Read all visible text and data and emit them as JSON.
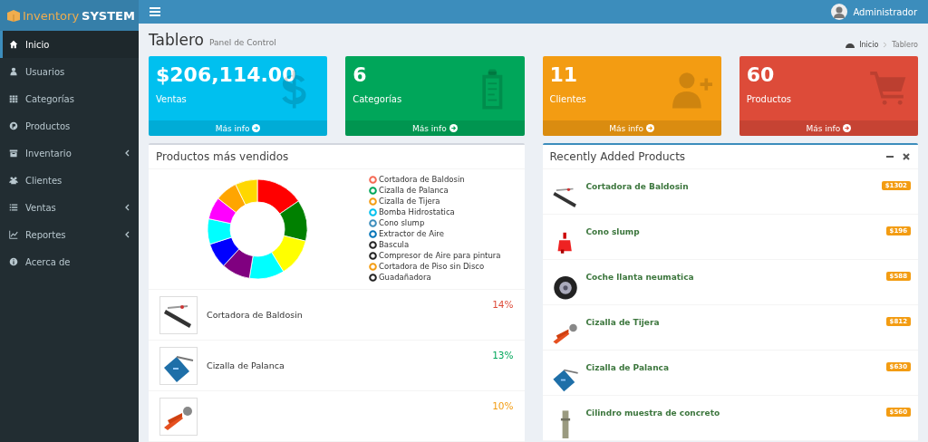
{
  "logo": {
    "part_1": "Inventory",
    "part_2": "SYSTEM"
  },
  "user": {
    "name": "Administrador"
  },
  "sidebar": {
    "items": [
      {
        "label": "Inicio",
        "selected": true,
        "has_submenu": false
      },
      {
        "label": "Usuarios",
        "selected": false,
        "has_submenu": false
      },
      {
        "label": "Categorías",
        "selected": false,
        "has_submenu": false
      },
      {
        "label": "Productos",
        "selected": false,
        "has_submenu": false
      },
      {
        "label": "Inventario",
        "selected": false,
        "has_submenu": true
      },
      {
        "label": "Clientes",
        "selected": false,
        "has_submenu": false
      },
      {
        "label": "Ventas",
        "selected": false,
        "has_submenu": true
      },
      {
        "label": "Reportes",
        "selected": false,
        "has_submenu": true
      },
      {
        "label": "Acerca de",
        "selected": false,
        "has_submenu": false
      }
    ]
  },
  "header": {
    "title": "Tablero",
    "subtitle": "Panel de Control",
    "breadcrumb": [
      "Inicio",
      "Tablero"
    ]
  },
  "stat_boxes": [
    {
      "value": "$206,114.00",
      "label": "Ventas",
      "link": "Más info",
      "color": "#00c0ef"
    },
    {
      "value": "6",
      "label": "Categorías",
      "link": "Más info",
      "color": "#00a65a"
    },
    {
      "value": "11",
      "label": "Clientes",
      "link": "Más info",
      "color": "#f39c12"
    },
    {
      "value": "60",
      "label": "Productos",
      "link": "Más info",
      "color": "#dd4b39"
    }
  ],
  "top_products": {
    "title": "Productos más vendidos",
    "legend": [
      {
        "label": "Cortadora de Baldosin",
        "color": "#f56954"
      },
      {
        "label": "Cizalla de Palanca",
        "color": "#00a65a"
      },
      {
        "label": "Cizalla de Tijera",
        "color": "#f39c12"
      },
      {
        "label": "Bomba Hidrostatica",
        "color": "#00c0ef"
      },
      {
        "label": "Cono slump",
        "color": "#3c8dbc"
      },
      {
        "label": "Extractor de Aire",
        "color": "#0073b7"
      },
      {
        "label": "Bascula",
        "color": "#222222"
      },
      {
        "label": "Compresor de Aire para pintura",
        "color": "#222222"
      },
      {
        "label": "Cortadora de Piso sin Disco",
        "color": "#f39c12"
      },
      {
        "label": "Guadañadora",
        "color": "#222222"
      }
    ],
    "rows": [
      {
        "name": "Cortadora de Baldosin",
        "percent": "14%",
        "color": "#dd4b39"
      },
      {
        "name": "Cizalla de Palanca",
        "percent": "13%",
        "color": "#00a65a"
      },
      {
        "percent": "10%",
        "color": "#f39c12"
      }
    ]
  },
  "recent_products": {
    "title": "Recently Added Products",
    "items": [
      {
        "name": "Cortadora de Baldosin",
        "price": "$1302"
      },
      {
        "name": "Cono slump",
        "price": "$196"
      },
      {
        "name": "Coche llanta neumatica",
        "price": "$588"
      },
      {
        "name": "Cizalla de Tijera",
        "price": "$812"
      },
      {
        "name": "Cizalla de Palanca",
        "price": "$630"
      },
      {
        "name": "Cilindro muestra de concreto",
        "price": "$560"
      }
    ]
  }
}
